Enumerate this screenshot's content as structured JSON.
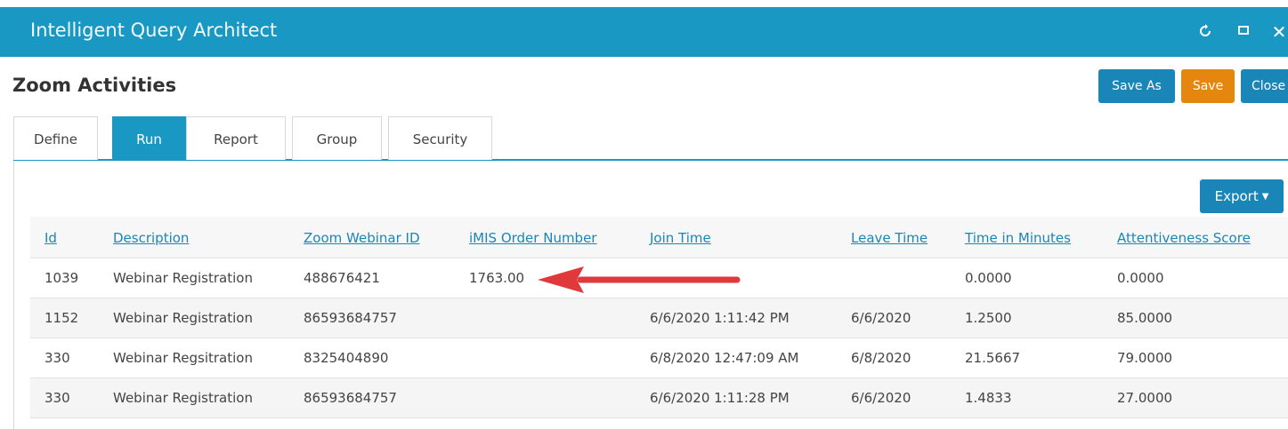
{
  "window": {
    "title": "Intelligent Query Architect",
    "icons": [
      "refresh-icon",
      "maximize-icon",
      "close-icon"
    ],
    "close_glyph": "✕"
  },
  "page": {
    "title": "Zoom Activities"
  },
  "actions": {
    "save_as": "Save As",
    "save": "Save",
    "close": "Close"
  },
  "tabs": [
    {
      "label": "Define",
      "active": false
    },
    {
      "label": "Run",
      "active": true
    },
    {
      "label": "Report",
      "active": false
    },
    {
      "label": "Group",
      "active": false
    },
    {
      "label": "Security",
      "active": false
    }
  ],
  "export": {
    "label": "Export"
  },
  "table": {
    "columns": [
      "Id",
      "Description",
      "Zoom Webinar ID",
      "iMIS Order Number",
      "Join Time",
      "Leave Time",
      "Time in Minutes",
      "Attentiveness Score"
    ],
    "rows": [
      [
        "1039",
        "Webinar Registration",
        "488676421",
        "1763.00",
        "",
        "",
        "0.0000",
        "0.0000"
      ],
      [
        "1152",
        "Webinar Registration",
        "86593684757",
        "",
        "6/6/2020 1:11:42 PM",
        "6/6/2020",
        "1.2500",
        "85.0000"
      ],
      [
        "330",
        "Webinar Regsitration",
        "8325404890",
        "",
        "6/8/2020 12:47:09 AM",
        "6/8/2020",
        "21.5667",
        "79.0000"
      ],
      [
        "330",
        "Webinar Registration",
        "86593684757",
        "",
        "6/6/2020 1:11:28 PM",
        "6/6/2020",
        "1.4833",
        "27.0000"
      ]
    ]
  },
  "colors": {
    "titlebar": "#1a98c4",
    "primary_button": "#1a86b8",
    "save_button": "#e5870f",
    "annotation_arrow": "#e0393b"
  }
}
